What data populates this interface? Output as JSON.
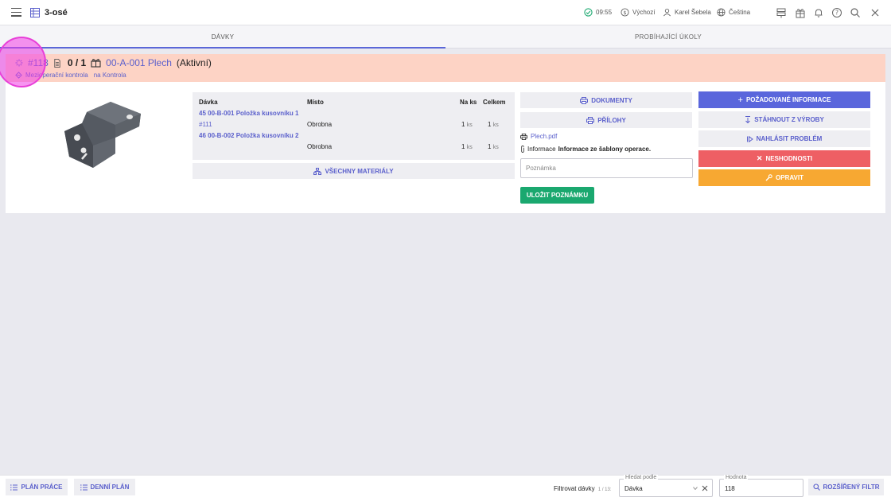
{
  "topbar": {
    "title": "3-osé",
    "time": "09:55",
    "workspace": "Výchozí",
    "user": "Karel Šebela",
    "language": "Čeština"
  },
  "tabs": [
    {
      "label": "DÁVKY",
      "active": true
    },
    {
      "label": "PROBÍHAJÍCÍ ÚKOLY",
      "active": false
    }
  ],
  "header": {
    "id": "#118",
    "count": "0 / 1",
    "part": "00-A-001 Plech",
    "state": "(Aktivní)",
    "operation": "Mezioperační kontrola",
    "target": "na Kontrola"
  },
  "table": {
    "headers": [
      "Dávka",
      "Místo",
      "Na ks",
      "Celkem"
    ],
    "rows": [
      {
        "batch": "45 00-B-001 Položka kusovníku 1",
        "sub": "#111",
        "place": "Obrobna",
        "qty": "1",
        "qty_unit": "ks",
        "total": "1",
        "total_unit": "ks"
      },
      {
        "batch": "46 00-B-002 Položka kusovníku 2",
        "sub": "",
        "place": "Obrobna",
        "qty": "1",
        "qty_unit": "ks",
        "total": "1",
        "total_unit": "ks"
      }
    ]
  },
  "buttons": {
    "all_materials": "VŠECHNY MATERIÁLY",
    "documents": "DOKUMENTY",
    "attachments": "PŘÍLOHY",
    "required_info": "POŽADOVANÉ INFORMACE",
    "download": "STÁHNOUT Z VÝROBY",
    "report": "NAHLÁSIT PROBLÉM",
    "nonconformities": "NESHODNOSTI",
    "fix": "OPRAVIT",
    "save_note": "ULOŽIT POZNÁMKU"
  },
  "attachment_file": "Plech.pdf",
  "info": {
    "label": "Informace",
    "value": "Informace ze šablony operace."
  },
  "note": {
    "placeholder": "Poznámka"
  },
  "bottom": {
    "work_plan": "PLÁN PRÁCE",
    "daily_plan": "DENNÍ PLÁN",
    "filter_label": "Filtrovat dávky",
    "filter_count": "1 / 13:",
    "search_by_label": "Hledat podle",
    "search_by_value": "Dávka",
    "value_label": "Hodnota",
    "value": "118",
    "extended_filter": "ROZŠÍŘENÝ FILTR"
  },
  "colors": {
    "accent": "#5b60cc",
    "primary_button": "#5a66dc",
    "danger": "#ee5f64",
    "warning": "#f7a832",
    "success": "#1aa86f",
    "header_strip": "#fdd3c5"
  }
}
